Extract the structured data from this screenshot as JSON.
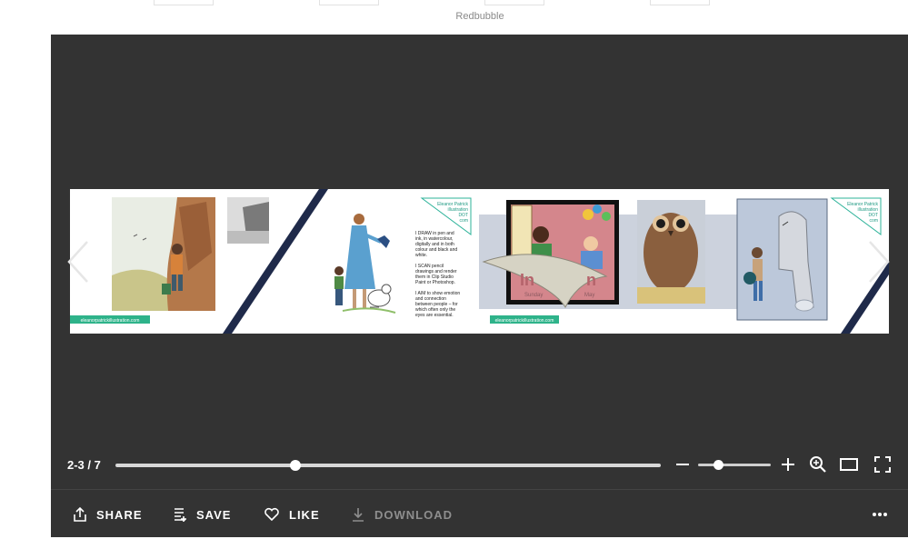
{
  "top_bar": {
    "brand": "Redbubble"
  },
  "viewer": {
    "page_indicator": "2-3 / 7",
    "progress_fraction": 0.33,
    "zoom_fraction": 0.28,
    "spread": {
      "credit_badge_left": "Eleanor Patrick illustration DOT com",
      "credit_badge_right": "Eleanor Patrick illustration DOT com",
      "url_tag": "eleanorpatrickillustration.com",
      "text_block": [
        "I DRAW in pen and ink, in watercolour, digitally and in both colour and black and white.",
        "I SCAN pencil drawings and render them in Clip Studio Paint or Photoshop.",
        "I AIM to show emotion and connection between people – for which often only the eyes are essential."
      ],
      "book_cover_title": "In Sun",
      "book_cover_subtitle": "Sunday May"
    }
  },
  "actions": {
    "share": "SHARE",
    "save": "SAVE",
    "like": "LIKE",
    "download": "DOWNLOAD"
  },
  "icons": [
    "share-icon",
    "save-icon",
    "heart-icon",
    "download-icon",
    "more-icon",
    "zoom-out-icon",
    "zoom-in-icon",
    "magnify-icon",
    "single-page-icon",
    "fullscreen-icon",
    "chevron-left-icon",
    "chevron-right-icon"
  ]
}
